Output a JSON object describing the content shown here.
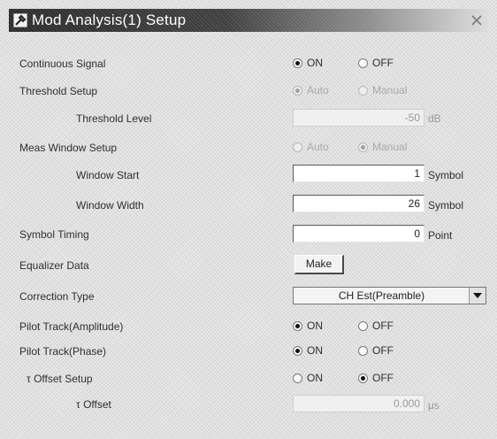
{
  "window": {
    "title": "Mod Analysis(1) Setup"
  },
  "rows": {
    "continuous_signal": {
      "label": "Continuous Signal",
      "options": [
        "ON",
        "OFF"
      ],
      "selected": "ON"
    },
    "threshold_setup": {
      "label": "Threshold Setup",
      "options": [
        "Auto",
        "Manual"
      ],
      "selected": "Auto",
      "enabled": false
    },
    "threshold_level": {
      "label": "Threshold Level",
      "value": "-50",
      "unit": "dB",
      "enabled": false
    },
    "meas_window_setup": {
      "label": "Meas Window Setup",
      "options": [
        "Auto",
        "Manual"
      ],
      "selected": "Manual",
      "enabled": false
    },
    "window_start": {
      "label": "Window Start",
      "value": "1",
      "unit": "Symbol"
    },
    "window_width": {
      "label": "Window Width",
      "value": "26",
      "unit": "Symbol"
    },
    "symbol_timing": {
      "label": "Symbol Timing",
      "value": "0",
      "unit": "Point"
    },
    "equalizer_data": {
      "label": "Equalizer Data",
      "button": "Make"
    },
    "correction_type": {
      "label": "Correction Type",
      "value": "CH Est(Preamble)"
    },
    "pilot_track_amplitude": {
      "label": "Pilot Track(Amplitude)",
      "options": [
        "ON",
        "OFF"
      ],
      "selected": "ON"
    },
    "pilot_track_phase": {
      "label": "Pilot Track(Phase)",
      "options": [
        "ON",
        "OFF"
      ],
      "selected": "ON"
    },
    "offset_setup": {
      "label": "τ Offset Setup",
      "options": [
        "ON",
        "OFF"
      ],
      "selected": "OFF"
    },
    "offset": {
      "label": "τ Offset",
      "value": "0.000",
      "unit": "μs",
      "enabled": false
    }
  },
  "icons": {
    "app": "wrench-icon",
    "close": "close-icon",
    "dropdown": "chevron-down-icon"
  }
}
